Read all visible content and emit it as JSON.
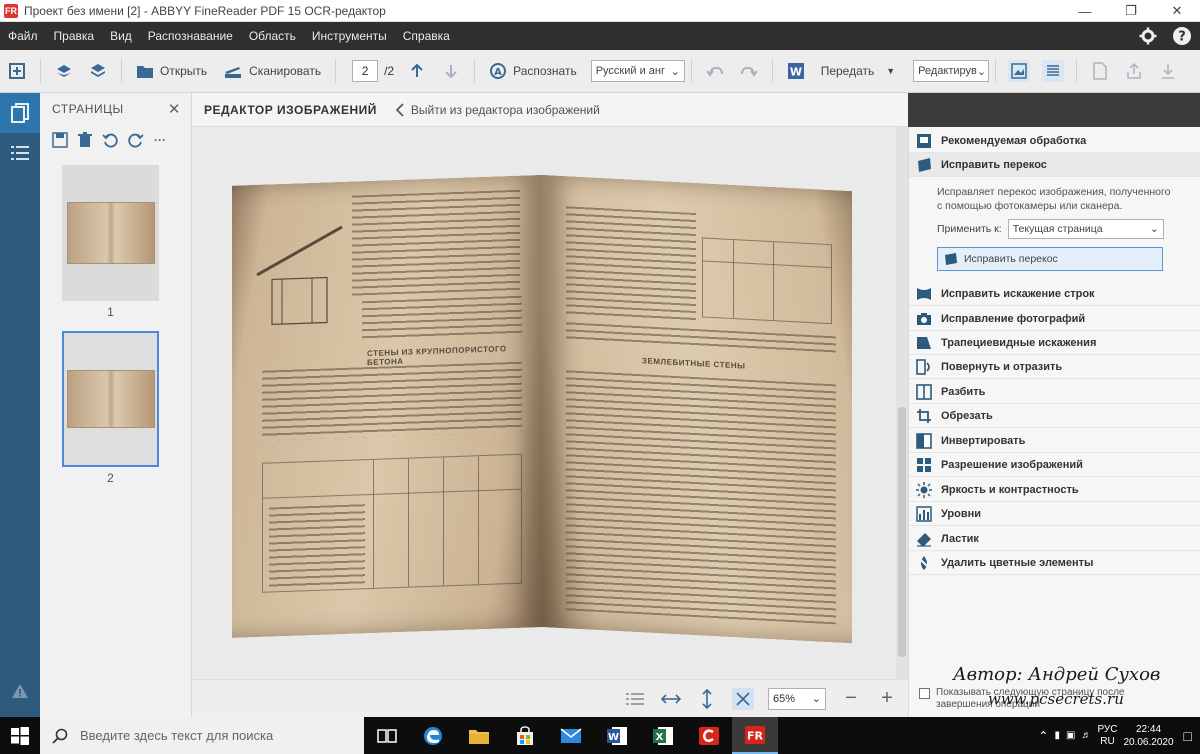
{
  "window": {
    "title": "Проект без имени [2] - ABBYY FineReader PDF 15 OCR-редактор",
    "logo_text": "FR"
  },
  "menu": {
    "items": [
      "Файл",
      "Правка",
      "Вид",
      "Распознавание",
      "Область",
      "Инструменты",
      "Справка"
    ]
  },
  "toolbar": {
    "open_label": "Открыть",
    "scan_label": "Сканировать",
    "page_current": "2",
    "page_total": "/2",
    "recognize_label": "Распознать",
    "language_value": "Русский и анг",
    "send_label": "Передать",
    "edit_value": "Редактирув"
  },
  "pages_panel": {
    "title": "СТРАНИЦЫ",
    "pages": [
      {
        "number": "1",
        "selected": false
      },
      {
        "number": "2",
        "selected": true
      }
    ]
  },
  "editor": {
    "title": "РЕДАКТОР ИЗОБРАЖЕНИЙ",
    "back_label": "Выйти из редактора изображений"
  },
  "book": {
    "left_heading": "СТЕНЫ ИЗ КРУПНОПОРИСТОГО БЕТОНА",
    "right_heading": "ЗЕМЛЕБИТНЫЕ СТЕНЫ"
  },
  "right_panel": {
    "recommended": "Рекомендуемая обработка",
    "deskew": {
      "title": "Исправить перекос",
      "description": "Исправляет перекос изображения, полученного с помощью фотокамеры или сканера.",
      "apply_label": "Применить к:",
      "apply_value": "Текущая страница",
      "button_label": "Исправить перекос"
    },
    "tools": [
      "Исправить искажение строк",
      "Исправление фотографий",
      "Трапециевидные искажения",
      "Повернуть и отразить",
      "Разбить",
      "Обрезать",
      "Инвертировать",
      "Разрешение изображений",
      "Яркость и контрастность",
      "Уровни",
      "Ластик",
      "Удалить цветные элементы"
    ],
    "show_next_page": "Показывать следующую страницу после завершения операции"
  },
  "bottom": {
    "zoom_value": "65%"
  },
  "watermark": {
    "author": "Автор: Андрей Сухов",
    "site": "www.pcsecrets.ru"
  },
  "taskbar": {
    "search_placeholder": "Введите здесь текст для поиска",
    "lang_top": "РУС",
    "lang_bottom": "RU",
    "time": "22:44",
    "date": "20.06.2020"
  },
  "colors": {
    "accent": "#1c6aa6",
    "nav_bg": "#1b4e73",
    "app_red": "#d9241c",
    "selection": "#3c7dd9"
  }
}
